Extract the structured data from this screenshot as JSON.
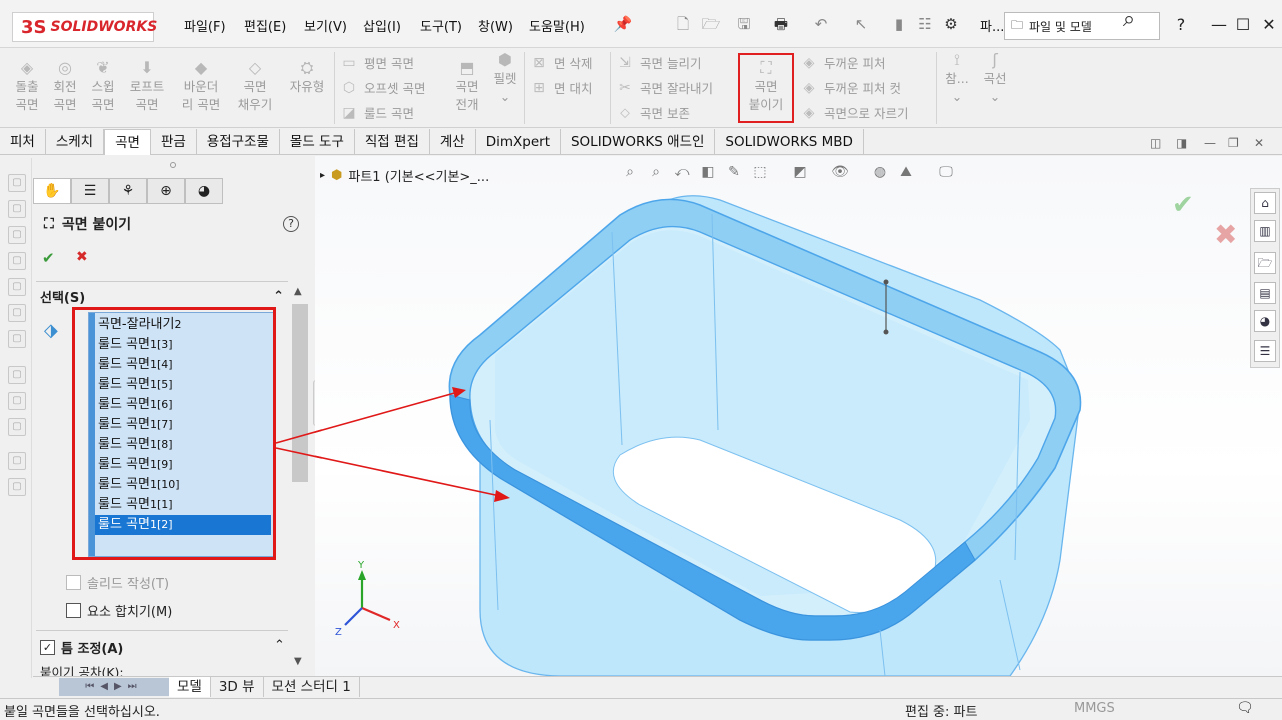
{
  "app": {
    "logo_text": "SOLIDWORKS",
    "logo_mark": "3S"
  },
  "menu": [
    "파일(F)",
    "편집(E)",
    "보기(V)",
    "삽입(I)",
    "도구(T)",
    "창(W)",
    "도움말(H)"
  ],
  "topbar": {
    "truncated_label": "파...",
    "search_placeholder": "파일 및 모델",
    "help": "?"
  },
  "ribbon": {
    "large_buttons": [
      {
        "line1": "돌출",
        "line2": "곡면"
      },
      {
        "line1": "회전",
        "line2": "곡면"
      },
      {
        "line1": "스윕",
        "line2": "곡면"
      },
      {
        "line1": "로프트",
        "line2": "곡면"
      },
      {
        "line1": "바운더",
        "line2": "리 곡면"
      },
      {
        "line1": "곡면",
        "line2": "채우기"
      },
      {
        "line1": "자유형",
        "line2": ""
      }
    ],
    "group2": [
      "평면 곡면",
      "오프셋 곡면",
      "룰드 곡면"
    ],
    "unfold": {
      "line1": "곡면",
      "line2": "전개"
    },
    "fillet": "필렛",
    "group3": [
      "면 삭제",
      "면 대치"
    ],
    "group4": [
      "곡면 늘리기",
      "곡면 잘라내기",
      "곡면 보존"
    ],
    "knit": {
      "line1": "곡면",
      "line2": "붙이기"
    },
    "group5": [
      "두꺼운 피처",
      "두꺼운 피처 컷",
      "곡면으로 자르기"
    ],
    "ref": "참...",
    "curve": "곡선"
  },
  "tabs": [
    "피처",
    "스케치",
    "곡면",
    "판금",
    "용접구조물",
    "몰드 도구",
    "직접 편집",
    "계산",
    "DimXpert",
    "SOLIDWORKS 애드인",
    "SOLIDWORKS MBD"
  ],
  "active_tab": "곡면",
  "property_manager": {
    "title": "곡면 붙이기",
    "help": "?",
    "section_selection": "선택(S)",
    "items": [
      {
        "name": "곡면-잘라내기",
        "sub": "2"
      },
      {
        "name": "룰드 곡면",
        "sub": "1[3]"
      },
      {
        "name": "룰드 곡면",
        "sub": "1[4]"
      },
      {
        "name": "룰드 곡면",
        "sub": "1[5]"
      },
      {
        "name": "룰드 곡면",
        "sub": "1[6]"
      },
      {
        "name": "룰드 곡면",
        "sub": "1[7]"
      },
      {
        "name": "룰드 곡면",
        "sub": "1[8]"
      },
      {
        "name": "룰드 곡면",
        "sub": "1[9]"
      },
      {
        "name": "룰드 곡면",
        "sub": "1[10]"
      },
      {
        "name": "룰드 곡면",
        "sub": "1[1]"
      },
      {
        "name": "룰드 곡면",
        "sub": "1[2]"
      }
    ],
    "selected_index": 10,
    "solid_create": "솔리드 작성(T)",
    "merge_entities": "요소 합치기(M)",
    "gap_control": "틈 조정(A)",
    "knit_tolerance": "붙이기 공차(K):"
  },
  "viewport": {
    "tree_label": "파트1  (기본<<기본>_..."
  },
  "bottom_tabs": [
    "모델",
    "3D 뷰",
    "모션 스터디 1"
  ],
  "status": {
    "message": "붙일 곡면들을 선택하십시오.",
    "mode": "편집 중: 파트",
    "units": "MMGS"
  },
  "colors": {
    "accent_red": "#e01818",
    "surface_blue": "#5aaef0",
    "list_bg": "#cfe3f6"
  }
}
